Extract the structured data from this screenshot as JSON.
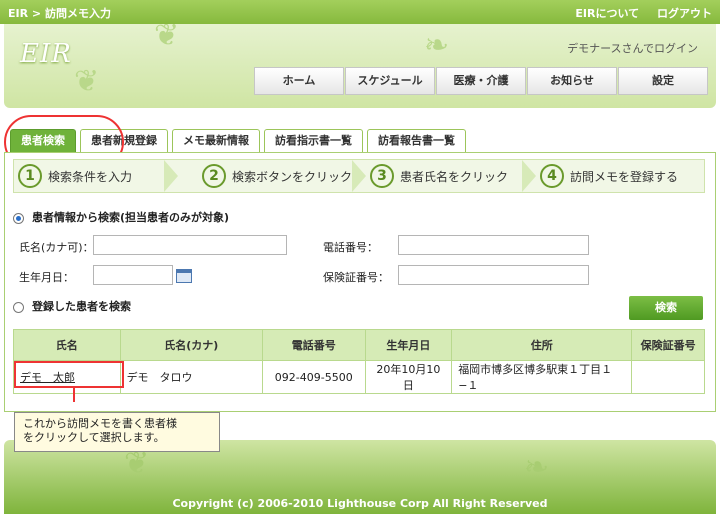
{
  "topbar": {
    "breadcrumb": "EIR > 訪問メモ入力",
    "about": "EIRについて",
    "logout": "ログアウト"
  },
  "header": {
    "logo": "EIR",
    "login_status": "デモナースさんでログイン",
    "nav": [
      "ホーム",
      "スケジュール",
      "医療・介護",
      "お知らせ",
      "設定"
    ]
  },
  "tabs": [
    "患者検索",
    "患者新規登録",
    "メモ最新情報",
    "訪看指示書一覧",
    "訪看報告書一覧"
  ],
  "steps": [
    {
      "num": "1",
      "label": "検索条件を入力"
    },
    {
      "num": "2",
      "label": "検索ボタンをクリック"
    },
    {
      "num": "3",
      "label": "患者氏名をクリック"
    },
    {
      "num": "4",
      "label": "訪問メモを登録する"
    }
  ],
  "form": {
    "option_patient_info": "患者情報から検索(担当患者のみが対象)",
    "name_label": "氏名(カナ可)：",
    "phone_label": "電話番号：",
    "birth_label": "生年月日：",
    "insurance_label": "保険証番号：",
    "option_registered": "登録した患者を検索",
    "search_button": "検索"
  },
  "table": {
    "headers": [
      "氏名",
      "氏名(カナ)",
      "電話番号",
      "生年月日",
      "住所",
      "保険証番号"
    ],
    "rows": [
      {
        "name": "デモ　太郎",
        "kana": "デモ　タロウ",
        "phone": "092-409-5500",
        "birth": "20年10月10日",
        "address": "福岡市博多区博多駅東１丁目１−１",
        "insurance": ""
      }
    ]
  },
  "callout": {
    "line1": "これから訪問メモを書く患者様",
    "line2": "をクリックして選択します。"
  },
  "footer": {
    "copyright": "Copyright (c) 2006-2010 Lighthouse Corp All Right Reserved"
  },
  "colors": {
    "accent": "#6fb23a",
    "highlight": "#e33333"
  }
}
